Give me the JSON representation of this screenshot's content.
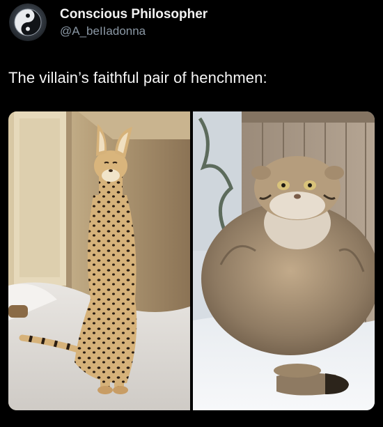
{
  "post": {
    "author": {
      "display_name": "Conscious Philosopher",
      "handle": "@A_beIIadonna",
      "avatar_icon": "yin-yang-icon"
    },
    "text": "The villain’s faithful pair of henchmen:",
    "media": [
      {
        "subject": "serval-cat",
        "icon": "photo"
      },
      {
        "subject": "pallas-cat",
        "icon": "photo"
      }
    ]
  }
}
